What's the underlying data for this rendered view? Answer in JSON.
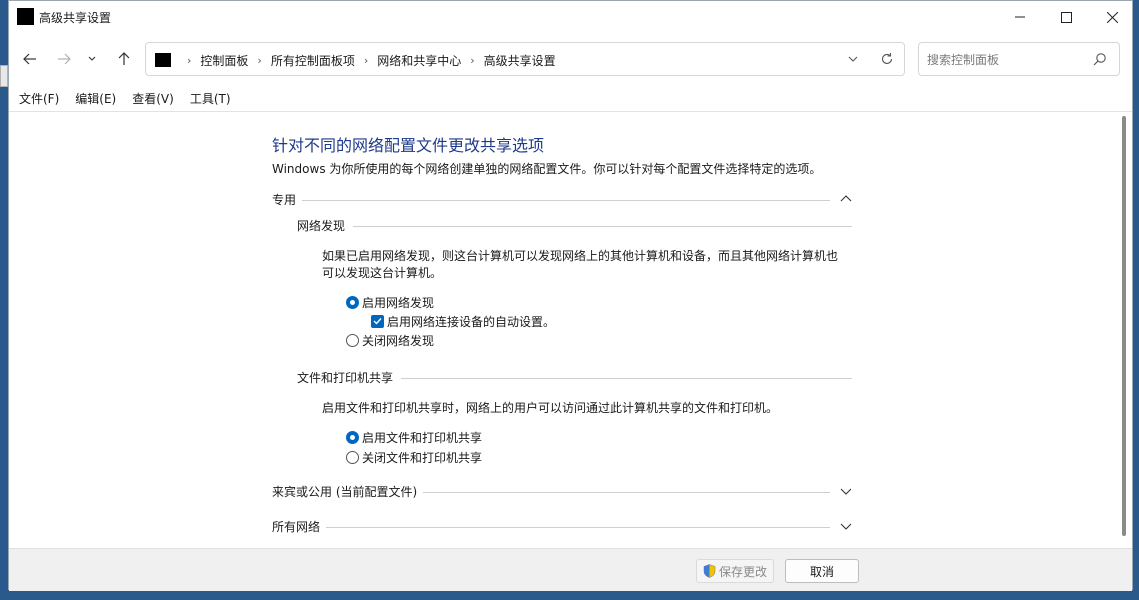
{
  "window": {
    "title": "高级共享设置"
  },
  "nav": {
    "breadcrumbs": [
      "控制面板",
      "所有控制面板项",
      "网络和共享中心",
      "高级共享设置"
    ]
  },
  "search": {
    "placeholder": "搜索控制面板"
  },
  "menu": [
    "文件(F)",
    "编辑(E)",
    "查看(V)",
    "工具(T)"
  ],
  "main": {
    "heading": "针对不同的网络配置文件更改共享选项",
    "description": "Windows 为你所使用的每个网络创建单独的网络配置文件。你可以针对每个配置文件选择特定的选项。",
    "sections": [
      {
        "label": "专用",
        "expanded": true,
        "groups": [
          {
            "label": "网络发现",
            "description_lines": [
              "如果已启用网络发现，则这台计算机可以发现网络上的其他计算机和设备，而且其他网络计算机也",
              "可以发现这台计算机。"
            ],
            "options": [
              {
                "label": "启用网络发现",
                "checked": true
              },
              {
                "label": "启用网络连接设备的自动设置。",
                "checked": true,
                "type": "checkbox"
              },
              {
                "label": "关闭网络发现",
                "checked": false
              }
            ]
          },
          {
            "label": "文件和打印机共享",
            "description_lines": [
              "启用文件和打印机共享时，网络上的用户可以访问通过此计算机共享的文件和打印机。"
            ],
            "options": [
              {
                "label": "启用文件和打印机共享",
                "checked": true
              },
              {
                "label": "关闭文件和打印机共享",
                "checked": false
              }
            ]
          }
        ]
      },
      {
        "label": "来宾或公用 (当前配置文件)",
        "expanded": false
      },
      {
        "label": "所有网络",
        "expanded": false
      }
    ]
  },
  "footer": {
    "save_label": "保存更改",
    "cancel_label": "取消"
  },
  "colors": {
    "accent": "#0067c0",
    "heading": "#1e3a8a"
  }
}
